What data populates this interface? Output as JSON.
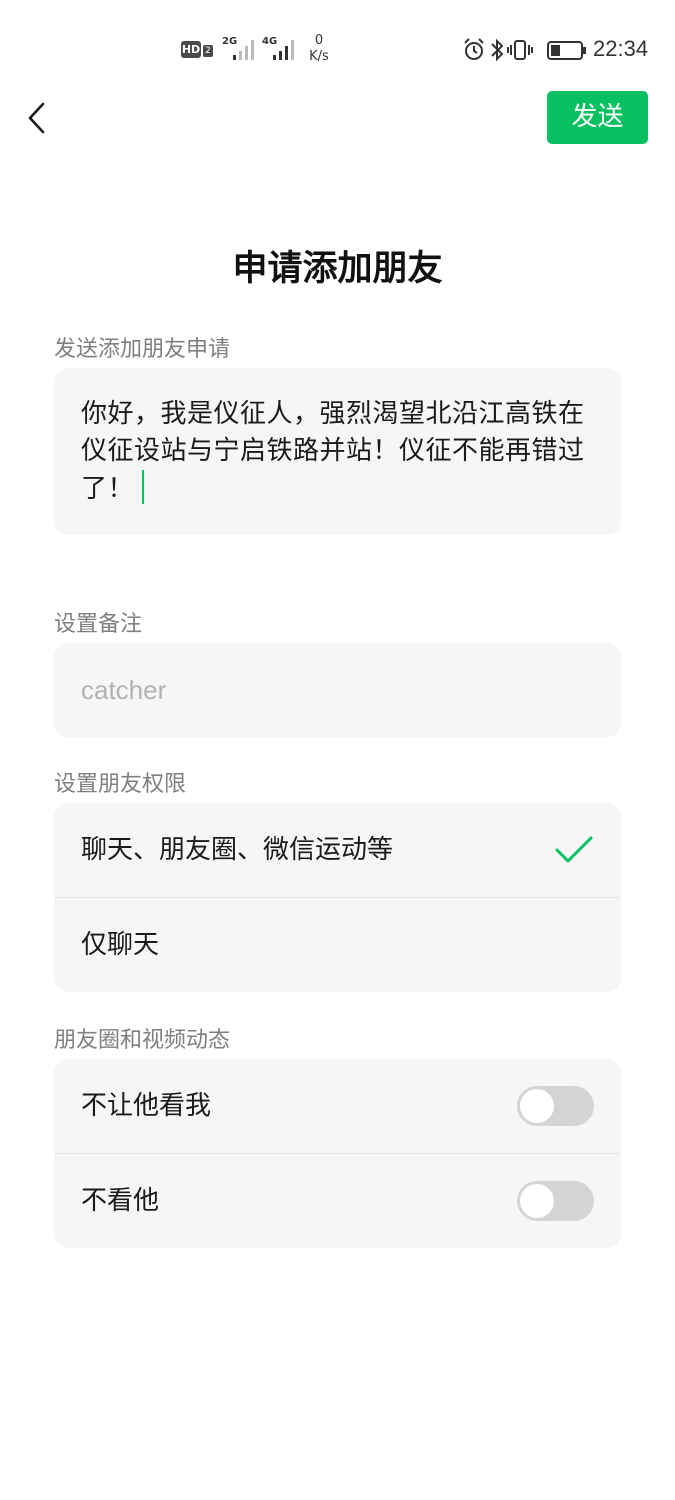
{
  "status_bar": {
    "hd_label": "HD",
    "hd_sub": "2",
    "net1_label": "2G",
    "net2_label": "4G",
    "speed_value": "0",
    "speed_unit": "K/s",
    "time": "22:34"
  },
  "nav": {
    "back_icon": "chevron-left-icon",
    "send_label": "发送"
  },
  "page": {
    "title": "申请添加朋友"
  },
  "request": {
    "label": "发送添加朋友申请",
    "message": "你好，我是仪征人，强烈渴望北沿江高铁在仪征设站与宁启铁路并站！仪征不能再错过了！"
  },
  "remark": {
    "label": "设置备注",
    "value": "",
    "placeholder": "catcher"
  },
  "permissions": {
    "label": "设置朋友权限",
    "options": [
      {
        "label": "聊天、朋友圈、微信运动等",
        "selected": true
      },
      {
        "label": "仅聊天",
        "selected": false
      }
    ]
  },
  "moments": {
    "label": "朋友圈和视频动态",
    "toggles": [
      {
        "label": "不让他看我",
        "on": false
      },
      {
        "label": "不看他",
        "on": false
      }
    ]
  },
  "colors": {
    "accent": "#07c160",
    "card_bg": "#f6f6f6",
    "label_gray": "#7f7f7f",
    "placeholder_gray": "#b2b2b2"
  }
}
